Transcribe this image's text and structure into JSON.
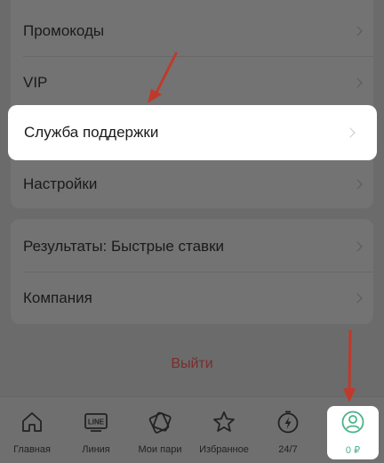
{
  "menu": {
    "items": [
      {
        "label": "Промокоды"
      },
      {
        "label": "VIP"
      },
      {
        "label": "Служба поддержки"
      },
      {
        "label": "Настройки"
      }
    ],
    "items2": [
      {
        "label": "Результаты: Быстрые ставки"
      },
      {
        "label": "Компания"
      }
    ],
    "logout_label": "Выйти"
  },
  "tabbar": {
    "tabs": [
      {
        "label": "Главная",
        "icon": "home-icon"
      },
      {
        "label": "Линия",
        "icon": "line-icon"
      },
      {
        "label": "Мои пари",
        "icon": "tickets-icon"
      },
      {
        "label": "Избранное",
        "icon": "star-icon"
      },
      {
        "label": "24/7",
        "icon": "lightning-icon"
      },
      {
        "label": "0 ₽",
        "icon": "profile-icon"
      }
    ]
  },
  "colors": {
    "arrow": "#c0392b",
    "accent": "#4bb38a",
    "logout": "#7b2c2c"
  }
}
